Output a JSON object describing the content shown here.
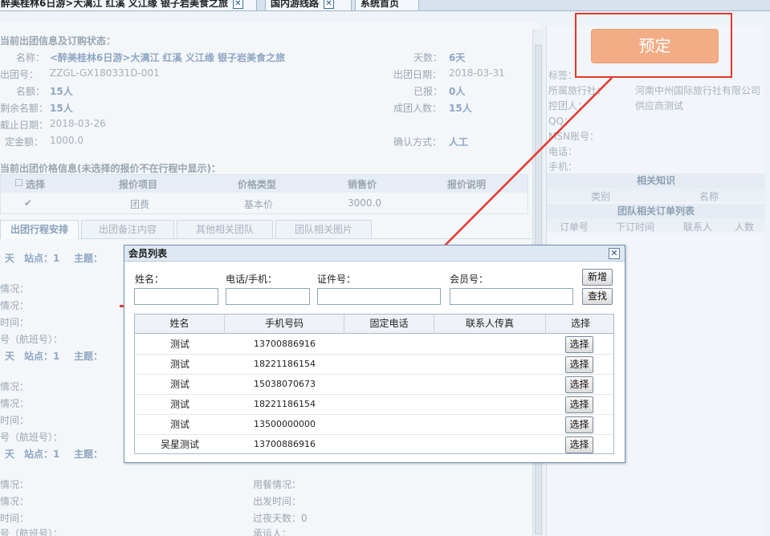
{
  "tabs": [
    {
      "label": "醉美桂林6日游>大漓江 红溪 义江缘 银子岩美食之旅",
      "close": "✕"
    },
    {
      "label": "国内游线路",
      "close": "✕"
    },
    {
      "label": "系统首页"
    }
  ],
  "left": {
    "section_title": "当前出团信息及订购状态：",
    "fields": {
      "name_label": "名称：",
      "name_value": "<醉美桂林6日游>大漓江 红溪 义江缘 银子岩美食之旅",
      "days_label": "天数：",
      "days_value": "6天",
      "groupno_label": "出团号：",
      "groupno_value": "ZZGL-GX180331D-001",
      "date_label": "出团日期：",
      "date_value": "2018-03-31",
      "quota_label": "名额：",
      "quota_value": "15人",
      "reported_label": "已报：",
      "reported_value": "0人",
      "remain_label": "剩余名额：",
      "remain_value": "15人",
      "min_label": "成团人数：",
      "min_value": "15人",
      "deadline_label": "截止日期：",
      "deadline_value": "2018-03-26",
      "deposit_label": "定金额：",
      "deposit_value": "1000.0",
      "confirm_label": "确认方式：",
      "confirm_value": "人工"
    },
    "price_title": "当前出团价格信息(未选择的报价不在行程中显示)：",
    "price_headers": [
      "选择",
      "报价项目",
      "价格类型",
      "销售价",
      "报价说明"
    ],
    "price_row": {
      "check": "✔",
      "item": "团费",
      "type": "基本价",
      "price": "3000.0"
    },
    "subtabs": [
      "出团行程安排",
      "出团备注内容",
      "其他相关团队",
      "团队相关图片"
    ],
    "day_label": "天",
    "station_text": "站点：1",
    "theme_label": "主题：",
    "row_labels": [
      "情况：",
      "情况：",
      "时间：",
      "号（航班号）："
    ],
    "bottom_labels": {
      "meal": "用餐情况：",
      "depart": "出发时间：",
      "overnight": "过夜天数：0",
      "carrier": "承运人："
    }
  },
  "right": {
    "book_button": "预定",
    "labels": {
      "tag": "标签：",
      "agency": "所属旅行社：",
      "agency_value": "河南中州国际旅行社有限公司",
      "controller": "控团人：",
      "controller_value": "供应商测试",
      "qq": "QQ：",
      "msn": "MSN账号：",
      "phone": "电话：",
      "mobile": "手机："
    },
    "knowledge_title": "相关知识",
    "knowledge_headers": [
      "类别",
      "名称"
    ],
    "orders_title": "团队相关订单列表",
    "orders_headers": [
      "订单号",
      "下订时间",
      "联系人",
      "人数"
    ]
  },
  "modal": {
    "title": "会员列表",
    "close": "✕",
    "labels": {
      "name": "姓名：",
      "phone": "电话/手机：",
      "id": "证件号：",
      "member": "会员号："
    },
    "placeholders": {
      "name": "",
      "phone": "",
      "id": "",
      "member": ""
    },
    "add_button": "新增",
    "search_button": "查找",
    "headers": [
      "姓名",
      "手机号码",
      "固定电话",
      "联系人传真",
      "选择"
    ],
    "select_label": "选择",
    "rows": [
      {
        "name": "测试",
        "mobile": "13700886916"
      },
      {
        "name": "测试",
        "mobile": "18221186154"
      },
      {
        "name": "测试",
        "mobile": "15038070673"
      },
      {
        "name": "测试",
        "mobile": "18221186154"
      },
      {
        "name": "测试",
        "mobile": "13500000000"
      },
      {
        "name": "吴星测试",
        "mobile": "13700886916"
      }
    ]
  },
  "colors": {
    "accent_red": "#e8362e",
    "book_orange": "#f2ad86",
    "modal_header": "#dfe8f2"
  }
}
